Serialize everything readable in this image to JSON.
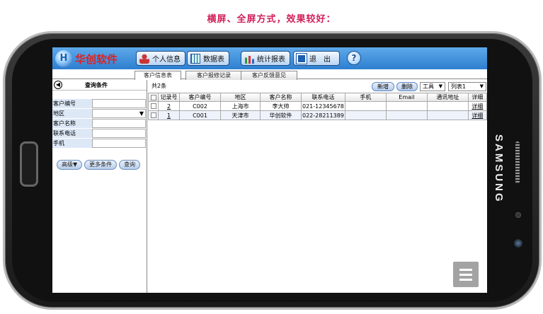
{
  "caption": "横屏、全屏方式，效果较好：",
  "device_brand": "SAMSUNG",
  "app": {
    "logo_letter": "H",
    "name": "华创软件",
    "toolbar": [
      "个人信息",
      "数据表",
      "统计报表",
      "退　出"
    ],
    "help": "?"
  },
  "tabs": [
    "客户信息表",
    "客户报修记录",
    "客户反馈意见"
  ],
  "left_panel": {
    "back_icon": "◀",
    "title": "查询条件",
    "fields": [
      {
        "label": "客户编号",
        "value": ""
      },
      {
        "label": "地区",
        "value": "▼"
      },
      {
        "label": "客户名称",
        "value": ""
      },
      {
        "label": "联系电话",
        "value": ""
      },
      {
        "label": "手机",
        "value": ""
      }
    ],
    "buttons": [
      "高级▼",
      "更多条件",
      "查询"
    ]
  },
  "main": {
    "count": "共2条",
    "new_btn": "新增",
    "delete_btn": "删除",
    "tools_select": "工具",
    "list_select": "列表1",
    "headers": [
      "",
      "记录号",
      "客户编号",
      "地区",
      "客户名称",
      "联系电话",
      "手机",
      "Email",
      "通讯地址",
      "详细"
    ],
    "rows": [
      {
        "id": "2",
        "code": "C002",
        "region": "上海市",
        "name": "李大帅",
        "phone": "021-12345678",
        "mobile": "",
        "email": "",
        "address": "",
        "detail": "详细"
      },
      {
        "id": "1",
        "code": "C001",
        "region": "天津市",
        "name": "华创软件",
        "phone": "022-28211389",
        "mobile": "",
        "email": "",
        "address": "",
        "detail": "详细"
      }
    ]
  },
  "colors": {
    "caption": "#d0205a",
    "toolbar_bg": "#2d7fd0",
    "app_name": "#e02020"
  }
}
